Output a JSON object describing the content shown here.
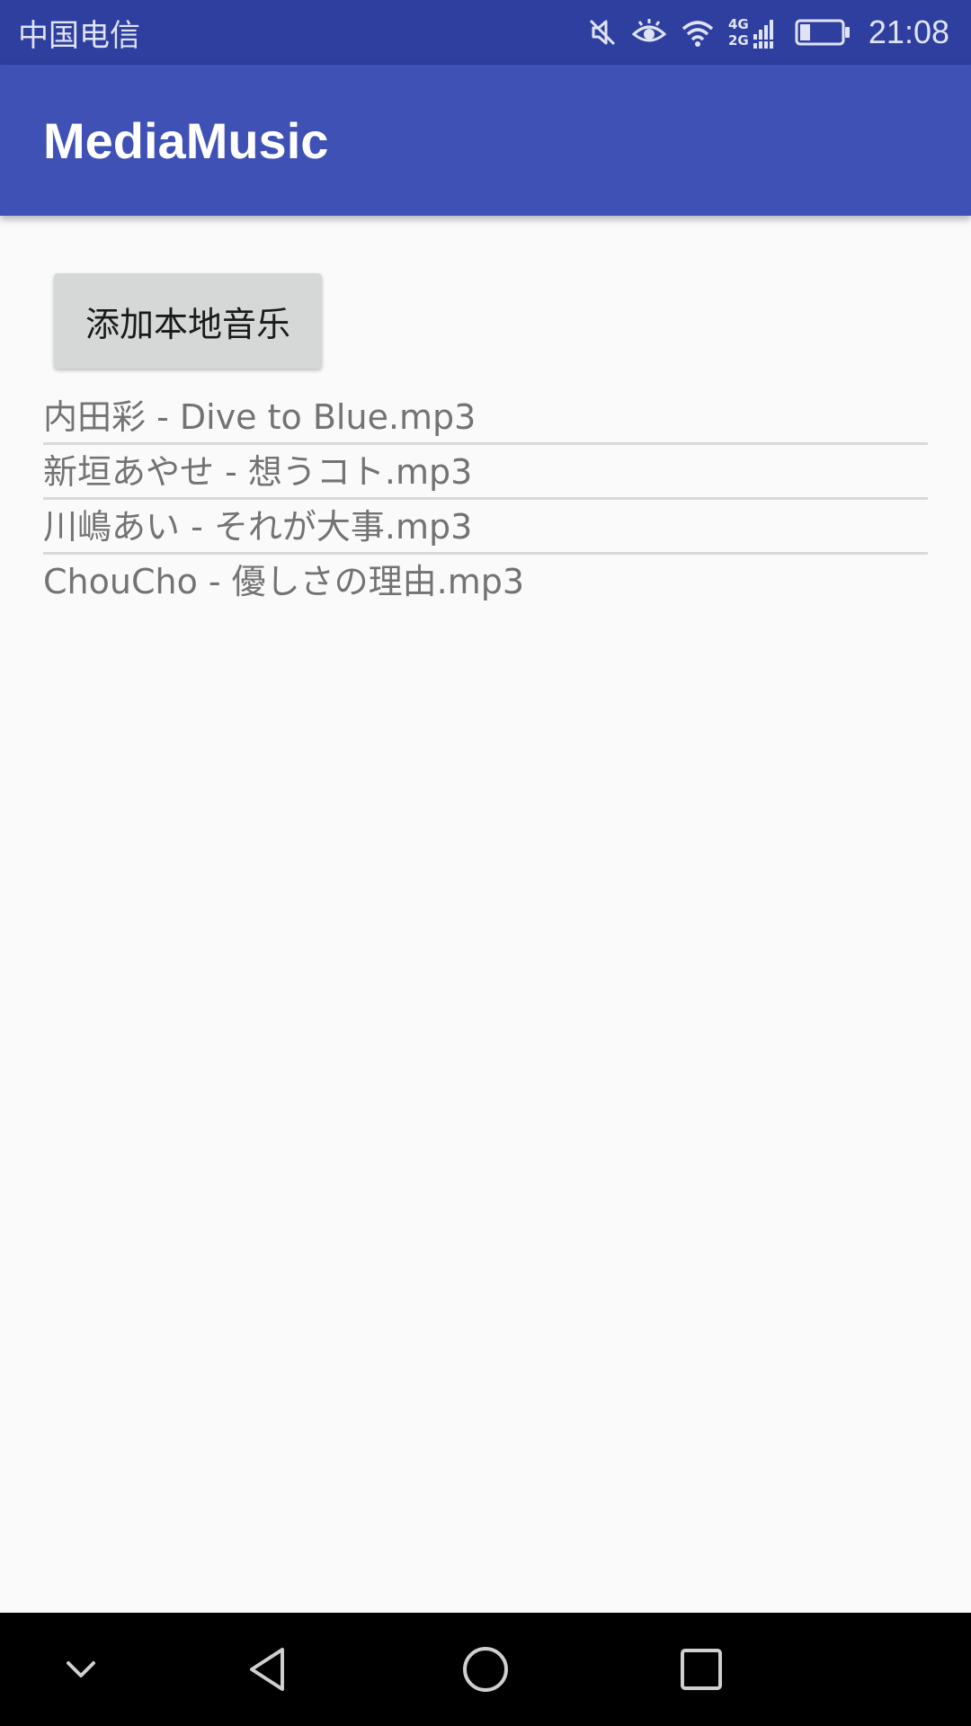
{
  "status_bar": {
    "carrier": "中国电信",
    "time": "21:08",
    "network_label_top": "4G",
    "network_label_bottom": "2G",
    "icons": [
      "mute-icon",
      "eye-comfort-icon",
      "wifi-icon",
      "signal-icon",
      "battery-icon"
    ],
    "battery_level": 0.25
  },
  "app_bar": {
    "title": "MediaMusic",
    "color": "#3f51b5"
  },
  "main": {
    "add_button_label": "添加本地音乐",
    "songs": [
      "内田彩 - Dive to Blue.mp3",
      "新垣あやせ - 想うコト.mp3",
      "川嶋あい - それが大事.mp3",
      "ChouCho - 優しさの理由.mp3"
    ]
  },
  "nav_bar": {
    "buttons": [
      "collapse-icon",
      "back-icon",
      "home-icon",
      "recents-icon"
    ]
  }
}
